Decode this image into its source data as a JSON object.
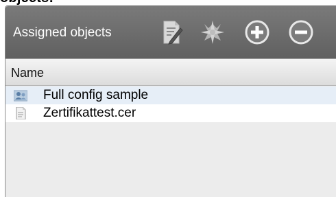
{
  "heading_fragment": "objects:",
  "panel": {
    "title": "Assigned objects",
    "toolbar": {
      "edit_icon": "edit-document-icon",
      "wizard_icon": "star-wand-icon",
      "add_icon": "plus-circle-icon",
      "remove_icon": "minus-circle-icon"
    }
  },
  "table": {
    "column_name": "Name",
    "rows": [
      {
        "label": "Full config sample",
        "icon": "user-group-icon"
      },
      {
        "label": "Zertifikattest.cer",
        "icon": "certificate-file-icon"
      }
    ]
  },
  "colors": {
    "header_bg": "#6e6e6e",
    "row_alt_bg": "#e6eef7",
    "panel_bg": "#ececec"
  }
}
